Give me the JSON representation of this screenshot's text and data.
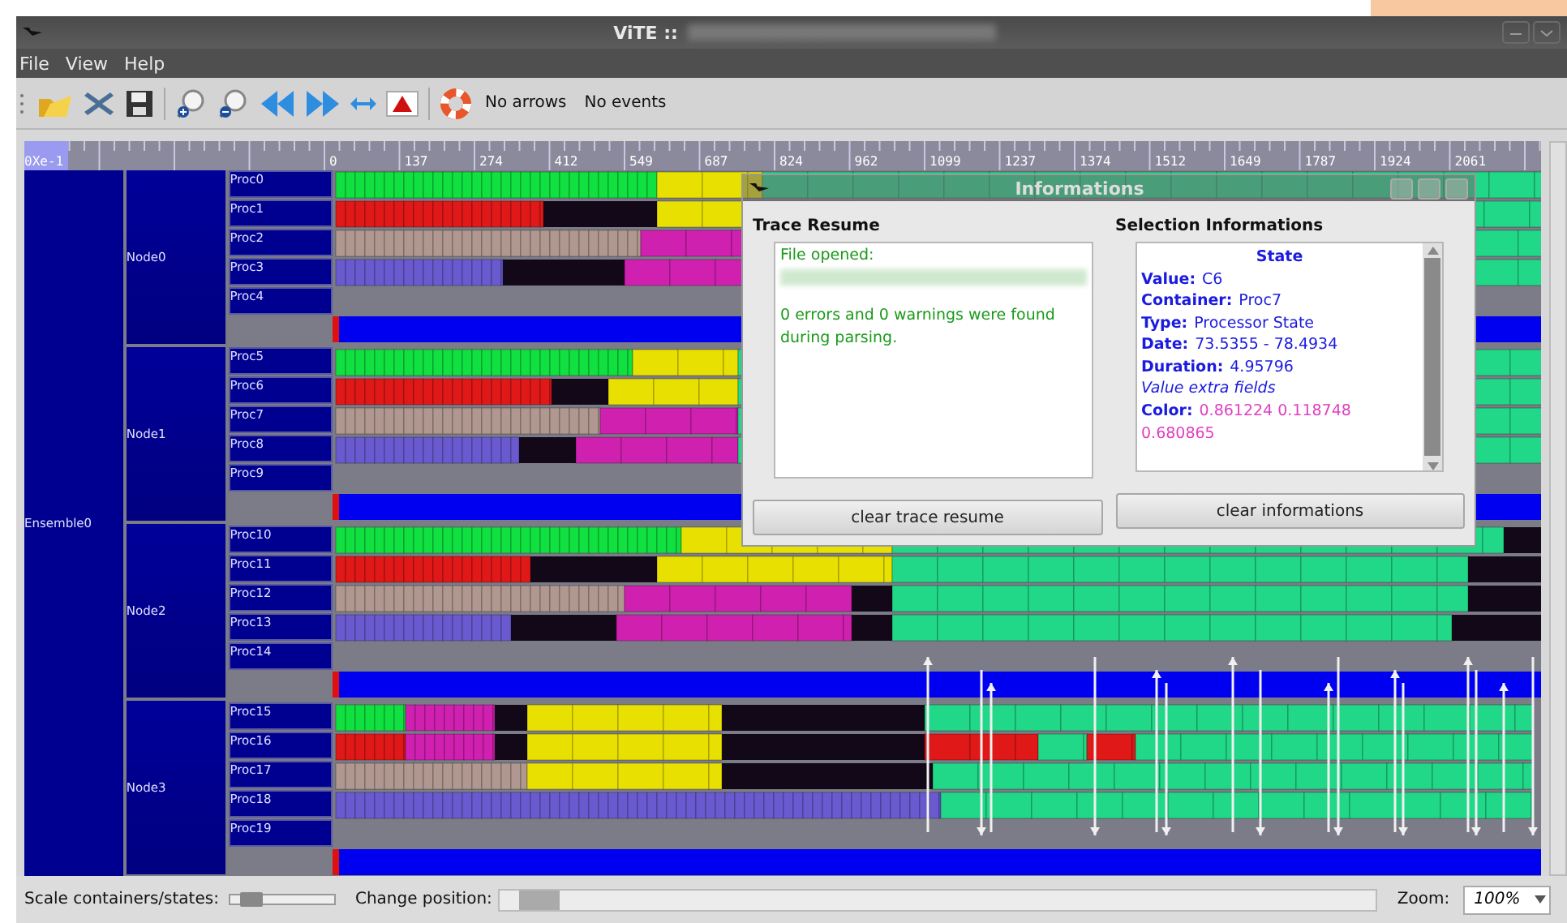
{
  "window": {
    "title": "ViTE ::"
  },
  "menu": [
    "File",
    "View",
    "Help"
  ],
  "toolbar": {
    "labels": [
      "No arrows",
      "No events"
    ]
  },
  "ruler": {
    "origin": "0Xe-1",
    "ticks": [
      "0",
      "137",
      "274",
      "412",
      "549",
      "687",
      "824",
      "962",
      "1099",
      "1237",
      "1374",
      "1512",
      "1649",
      "1787",
      "1924",
      "2061"
    ]
  },
  "containers": {
    "name": "Ensemble0",
    "children": [
      {
        "name": "Node0",
        "children": [
          {
            "name": "Proc0"
          },
          {
            "name": "Proc1"
          },
          {
            "name": "Proc2"
          },
          {
            "name": "Proc3"
          },
          {
            "name": "Proc4"
          }
        ]
      },
      {
        "name": "Node1",
        "children": [
          {
            "name": "Proc5"
          },
          {
            "name": "Proc6"
          },
          {
            "name": "Proc7"
          },
          {
            "name": "Proc8"
          },
          {
            "name": "Proc9"
          }
        ]
      },
      {
        "name": "Node2",
        "children": [
          {
            "name": "Proc10"
          },
          {
            "name": "Proc11"
          },
          {
            "name": "Proc12"
          },
          {
            "name": "Proc13"
          },
          {
            "name": "Proc14"
          }
        ]
      },
      {
        "name": "Node3",
        "children": [
          {
            "name": "Proc15"
          },
          {
            "name": "Proc16"
          },
          {
            "name": "Proc17"
          },
          {
            "name": "Proc18"
          },
          {
            "name": "Proc19"
          }
        ]
      }
    ]
  },
  "dialog": {
    "title": "Informations",
    "trace_resume": {
      "heading": "Trace Resume",
      "opened": "File opened:",
      "message": "0 errors and 0 warnings were found during parsing.",
      "button": "clear trace resume"
    },
    "selection": {
      "heading": "Selection Informations",
      "title": "State",
      "fields": [
        {
          "kind": "field",
          "label": "Value:",
          "value": "C6"
        },
        {
          "kind": "field",
          "label": "Container:",
          "value": "Proc7"
        },
        {
          "kind": "field",
          "label": "Type:",
          "value": "Processor State"
        },
        {
          "kind": "field",
          "label": "Date:",
          "value": "73.5355 - 78.4934"
        },
        {
          "kind": "field",
          "label": "Duration:",
          "value": "4.95796"
        },
        {
          "kind": "note",
          "text": "Value extra fields"
        },
        {
          "kind": "color",
          "label": "Color:",
          "value": "0.861224 0.118748 0.680865"
        }
      ],
      "button": "clear informations"
    }
  },
  "bottom": {
    "scale_label": "Scale containers/states:",
    "scale": {
      "level": 0.2
    },
    "position_label": "Change position:",
    "zoom_label": "Zoom:",
    "zoom": "100%"
  }
}
